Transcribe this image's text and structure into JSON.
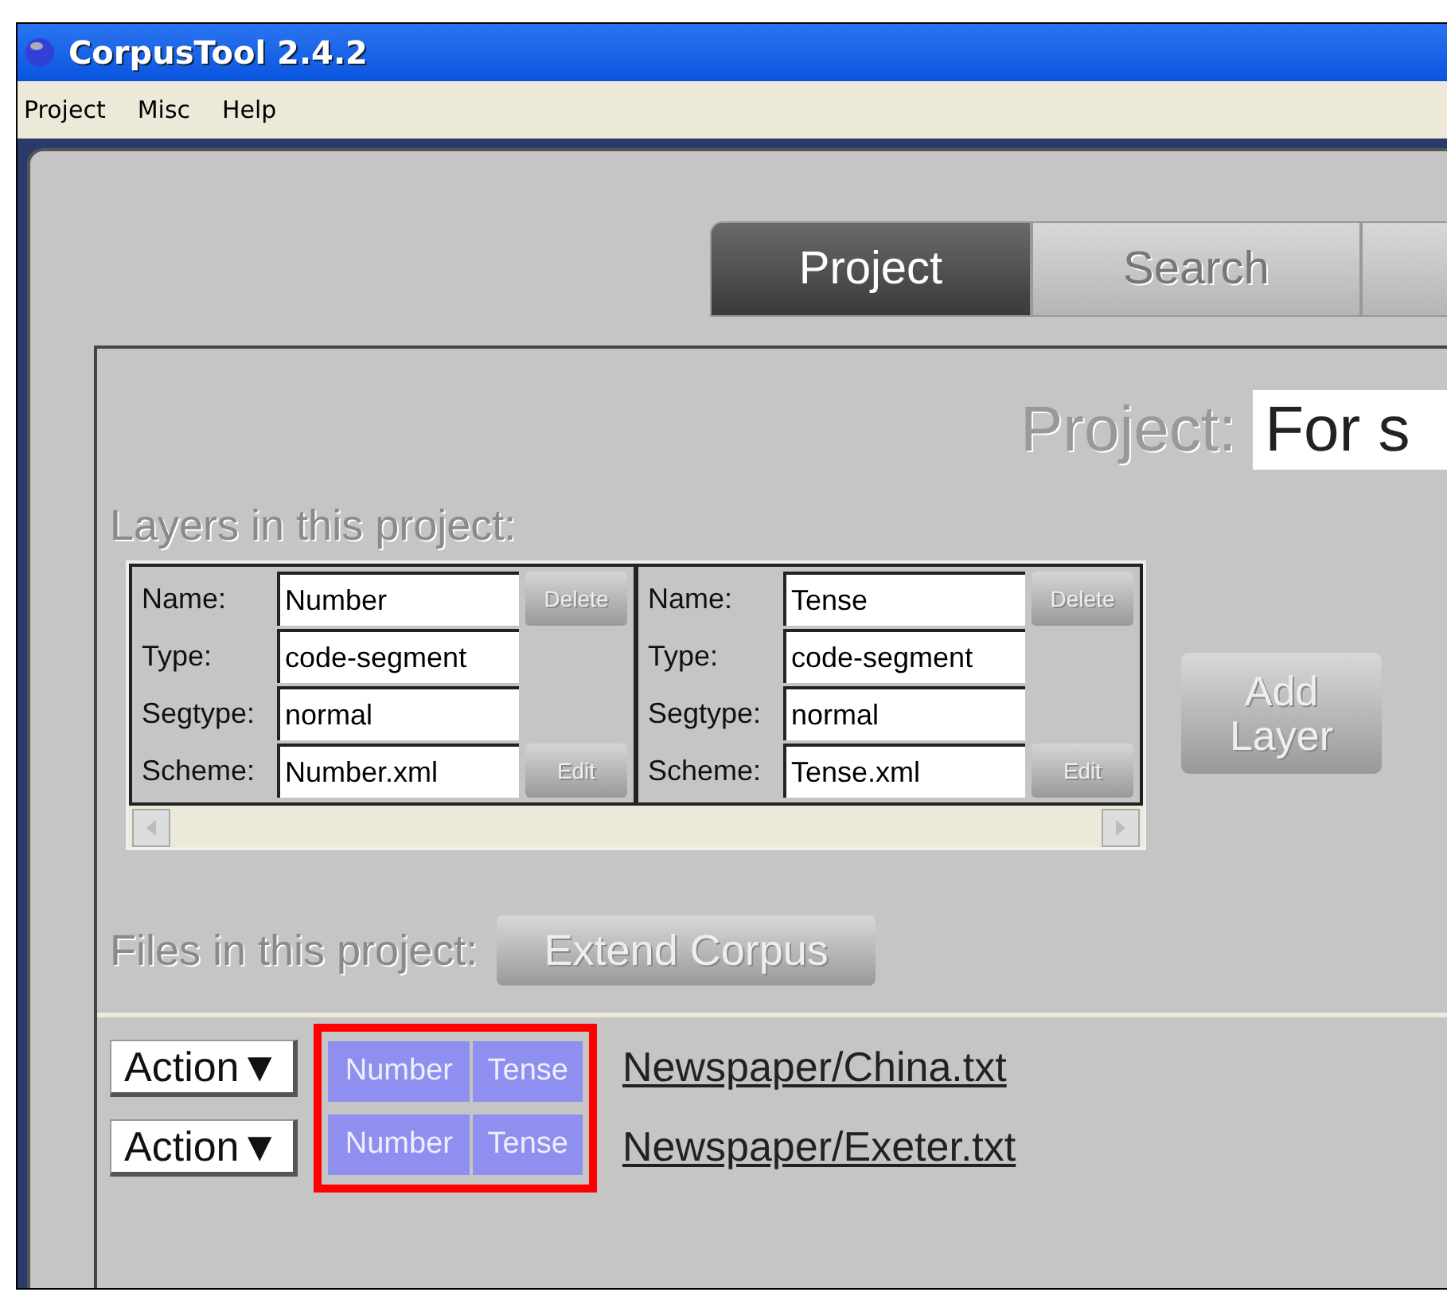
{
  "window": {
    "title": "CorpusTool 2.4.2"
  },
  "menu": [
    "Project",
    "Misc",
    "Help"
  ],
  "tabs": [
    {
      "label": "Project",
      "selected": true
    },
    {
      "label": "Search",
      "selected": false
    }
  ],
  "project": {
    "label": "Project:",
    "value": "For s"
  },
  "layers_heading": "Layers in this project:",
  "layers": [
    {
      "fields": [
        {
          "label": "Name:",
          "value": "Number"
        },
        {
          "label": "Type:",
          "value": "code-segment"
        },
        {
          "label": "Segtype:",
          "value": "normal"
        },
        {
          "label": "Scheme:",
          "value": "Number.xml"
        }
      ],
      "delete": "Delete",
      "edit": "Edit"
    },
    {
      "fields": [
        {
          "label": "Name:",
          "value": "Tense"
        },
        {
          "label": "Type:",
          "value": "code-segment"
        },
        {
          "label": "Segtype:",
          "value": "normal"
        },
        {
          "label": "Scheme:",
          "value": "Tense.xml"
        }
      ],
      "delete": "Delete",
      "edit": "Edit"
    }
  ],
  "add_layer": "Add Layer",
  "files_heading": "Files in this project:",
  "extend_button": "Extend Corpus",
  "files": [
    {
      "action": "Action▼",
      "layers": [
        "Number",
        "Tense"
      ],
      "path": "Newspaper/China.txt"
    },
    {
      "action": "Action▼",
      "layers": [
        "Number",
        "Tense"
      ],
      "path": "Newspaper/Exeter.txt"
    }
  ]
}
